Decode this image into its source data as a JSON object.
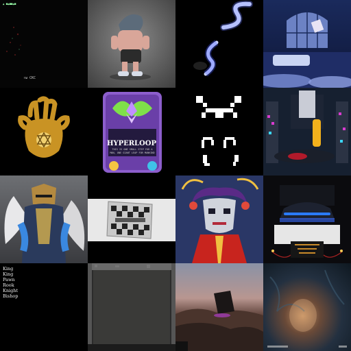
{
  "gallery": {
    "tiles": [
      {
        "name": "dark-particles",
        "caption_top": "▲ ■▲■■▲■",
        "caption_bottom": "↑ω CKC"
      },
      {
        "name": "3d-wolf-character"
      },
      {
        "name": "neon-swirl"
      },
      {
        "name": "night-bedroom"
      },
      {
        "name": "golden-hamsa-hand"
      },
      {
        "name": "hyperloop-card",
        "title": "HYPERLOOP",
        "flavor": "THIS IS ONE SMALL STEP FOR A MAN, ONE GIANT LEAP FOR MANKIND"
      },
      {
        "name": "pixel-glyphs"
      },
      {
        "name": "cyber-stage"
      },
      {
        "name": "winged-warrior"
      },
      {
        "name": "chrome-checkered-card"
      },
      {
        "name": "pixel-jester"
      },
      {
        "name": "neon-car-showroom"
      },
      {
        "name": "chess-pieces-list",
        "items": [
          "King",
          "King",
          "Pawn",
          "Rook",
          "Knight",
          "Bishop"
        ]
      },
      {
        "name": "dark-frame"
      },
      {
        "name": "desert-monolith"
      },
      {
        "name": "underwater-glow"
      }
    ]
  }
}
